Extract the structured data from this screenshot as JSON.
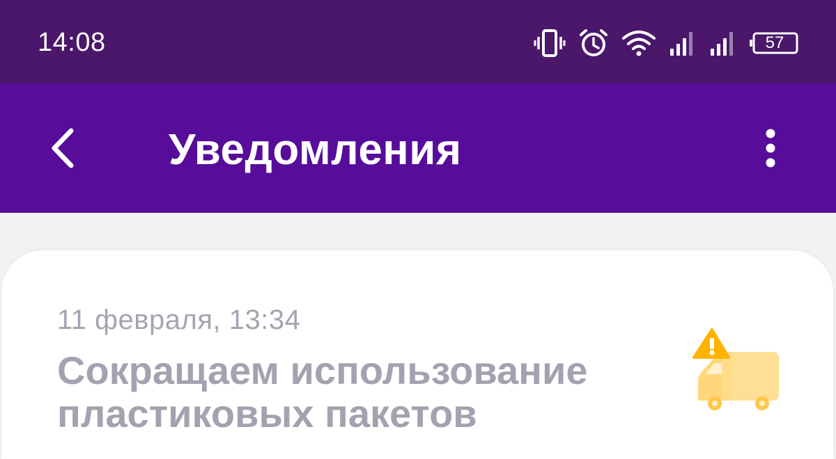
{
  "status_bar": {
    "time": "14:08",
    "battery_level": "57",
    "icons": [
      "vibrate-icon",
      "alarm-icon",
      "wifi-icon",
      "signal-icon",
      "signal-icon",
      "battery-icon"
    ]
  },
  "app_bar": {
    "title": "Уведомления",
    "back_icon": "chevron-left-icon",
    "menu_icon": "more-vertical-icon"
  },
  "notification": {
    "date": "11 февраля, 13:34",
    "title_line_1": "Сокращаем использование",
    "title_line_2": "пластиковых пакетов",
    "icon": "delivery-truck-warning-icon"
  },
  "colors": {
    "status_bar_bg": "#4a176b",
    "app_bar_bg": "#570d9a",
    "page_bg": "#f2f1f4",
    "date_text": "#a5a4b1",
    "title_text": "#a3a2b0",
    "truck_accent": "#ffcf60",
    "warning_accent": "#ffb300"
  }
}
